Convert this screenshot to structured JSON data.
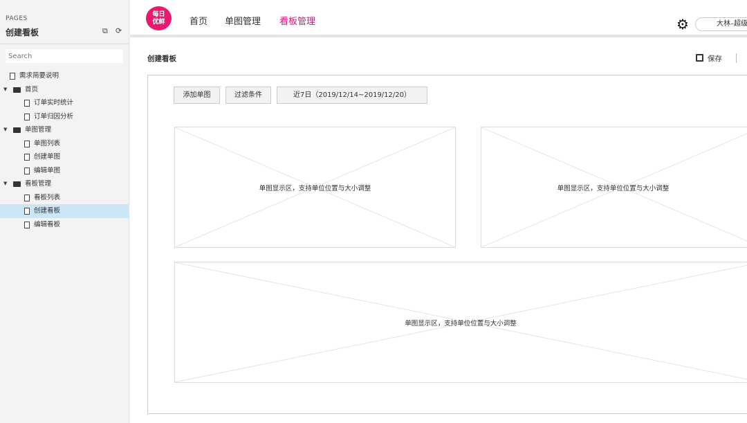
{
  "sidebar": {
    "pages_label": "PAGES",
    "title": "创建看板",
    "search_placeholder": "Search",
    "items": [
      {
        "label": "需求简要说明",
        "type": "page",
        "level": 0
      },
      {
        "label": "首页",
        "type": "folder",
        "level": 0
      },
      {
        "label": "订单实时统计",
        "type": "page",
        "level": 1
      },
      {
        "label": "订单归因分析",
        "type": "page",
        "level": 1
      },
      {
        "label": "单图管理",
        "type": "folder",
        "level": 0
      },
      {
        "label": "单图列表",
        "type": "page",
        "level": 1
      },
      {
        "label": "创建单图",
        "type": "page",
        "level": 1
      },
      {
        "label": "编辑单图",
        "type": "page",
        "level": 1
      },
      {
        "label": "看板管理",
        "type": "folder",
        "level": 0
      },
      {
        "label": "看板列表",
        "type": "page",
        "level": 1
      },
      {
        "label": "创建看板",
        "type": "page",
        "level": 1,
        "selected": true
      },
      {
        "label": "编辑看板",
        "type": "page",
        "level": 1
      }
    ]
  },
  "topbar": {
    "logo": "每日优鲜",
    "nav": [
      "首页",
      "单图管理",
      "看板管理"
    ],
    "active_nav": "看板管理",
    "user": "大林–超级管理员"
  },
  "main": {
    "breadcrumb": "创建看板",
    "save_label": "保存",
    "buttons": {
      "add": "添加单图",
      "filter": "过滤条件",
      "date": "近7日（2019/12/14~2019/12/20）"
    },
    "placeholders": [
      "单图显示区，支持单位位置与大小调整",
      "单图显示区，支持单位位置与大小调整",
      "单图显示区，支持单位位置与大小调整"
    ]
  },
  "colors": {
    "accent": "#e0147c",
    "selected": "#cde6f5"
  }
}
